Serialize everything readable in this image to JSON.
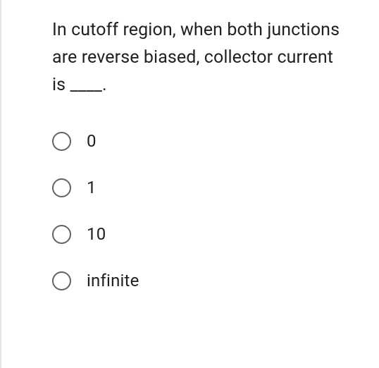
{
  "question": "In cutoff region, when both junctions are reverse biased, collector current is ____.",
  "options": [
    {
      "label": "0"
    },
    {
      "label": "1"
    },
    {
      "label": "10"
    },
    {
      "label": "infinite"
    }
  ]
}
